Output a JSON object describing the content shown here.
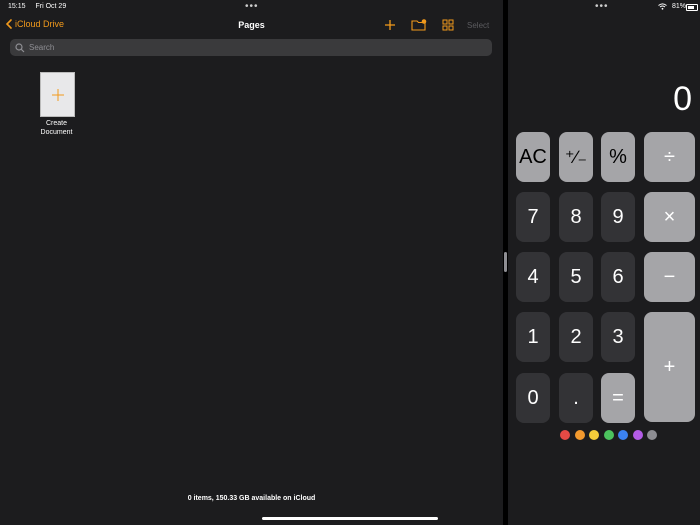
{
  "status": {
    "time": "15:15",
    "date": "Fri Oct 29",
    "battery": "81%"
  },
  "files": {
    "back_label": "iCloud Drive",
    "title": "Pages",
    "select_label": "Select",
    "search_placeholder": "Search",
    "create_label_line1": "Create",
    "create_label_line2": "Document",
    "footer": "0 items, 150.33 GB available on iCloud",
    "accent": "#f29a1c"
  },
  "calculator": {
    "display": "0",
    "keys": {
      "ac": "AC",
      "sign": "⁺∕₋",
      "percent": "%",
      "divide": "÷",
      "seven": "7",
      "eight": "8",
      "nine": "9",
      "multiply": "×",
      "four": "4",
      "five": "5",
      "six": "6",
      "minus": "−",
      "one": "1",
      "two": "2",
      "three": "3",
      "plus": "+",
      "zero": "0",
      "decimal": ".",
      "equals": "="
    },
    "color_dots": [
      "#e64a45",
      "#f29a2e",
      "#f5cc3a",
      "#4cc35e",
      "#3b82f0",
      "#b35ce6",
      "#8e8e93"
    ]
  }
}
